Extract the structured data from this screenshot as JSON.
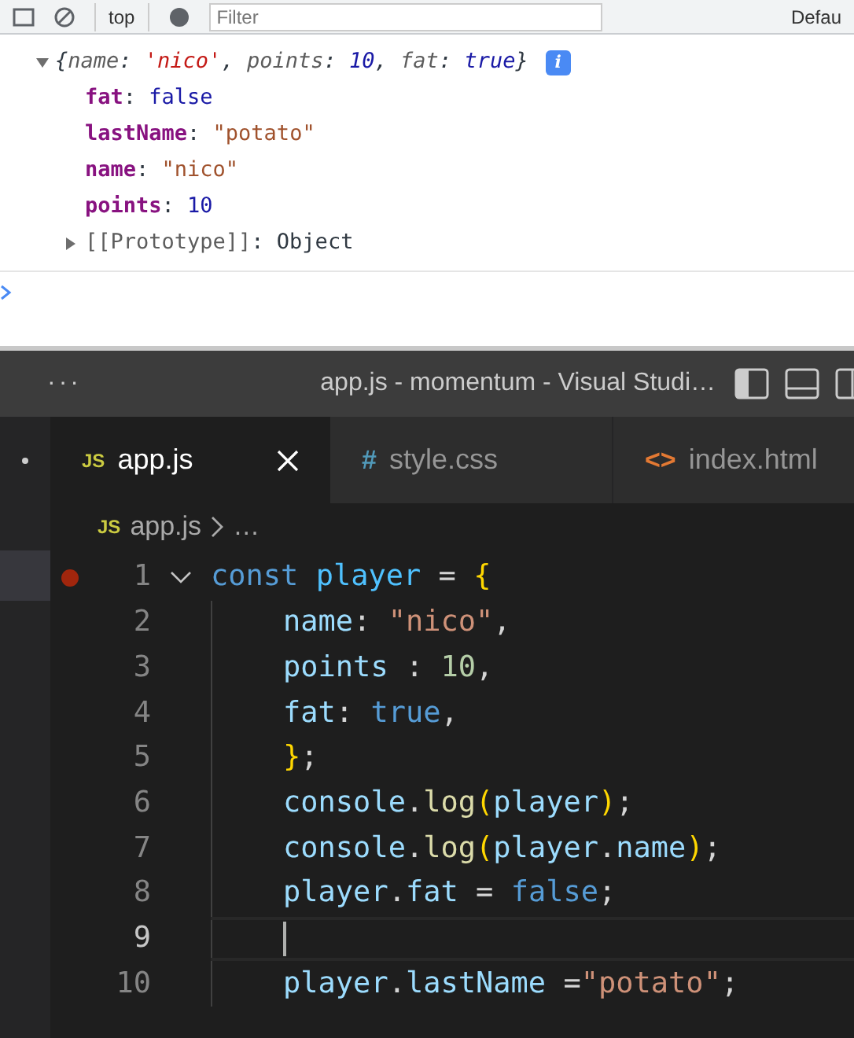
{
  "devtools_toolbar": {
    "context": "top",
    "filter": {
      "placeholder": "Filter"
    },
    "levels": "Defau"
  },
  "console": {
    "expanded": true,
    "summary": [
      {
        "t": "{",
        "kind": "punct"
      },
      {
        "t": "name",
        "kind": "key"
      },
      {
        "t": ": ",
        "kind": "punct"
      },
      {
        "t": "'nico'",
        "kind": "string"
      },
      {
        "t": ", ",
        "kind": "punct"
      },
      {
        "t": "points",
        "kind": "key"
      },
      {
        "t": ": ",
        "kind": "punct"
      },
      {
        "t": "10",
        "kind": "number"
      },
      {
        "t": ", ",
        "kind": "punct"
      },
      {
        "t": "fat",
        "kind": "key"
      },
      {
        "t": ": ",
        "kind": "punct"
      },
      {
        "t": "true",
        "kind": "bool"
      },
      {
        "t": "}",
        "kind": "punct"
      }
    ],
    "info_badge": "i",
    "properties": [
      {
        "key": "fat",
        "separator": ":",
        "value": "false",
        "kind": "bool"
      },
      {
        "key": "lastName",
        "separator": ":",
        "value": "\"potato\"",
        "kind": "string"
      },
      {
        "key": "name",
        "separator": ":",
        "value": "\"nico\"",
        "kind": "string"
      },
      {
        "key": "points",
        "separator": ":",
        "value": "10",
        "kind": "number"
      }
    ],
    "prototype": {
      "key": "[[Prototype]]",
      "separator": ":",
      "value": "Object",
      "expanded": false
    }
  },
  "editor": {
    "title": "app.js - momentum - Visual Studi…",
    "menu": "···",
    "tabs": [
      {
        "icon": "JS",
        "label": "app.js",
        "kind": "js",
        "selected": true
      },
      {
        "icon": "#",
        "label": "style.css",
        "kind": "css",
        "selected": false
      },
      {
        "icon": "<>",
        "label": "index.html",
        "kind": "html",
        "selected": false
      }
    ],
    "breadcrumb": {
      "icon": "JS",
      "file": "app.js",
      "rest": "…"
    },
    "lines": [
      {
        "number": "1",
        "breakpoint": true,
        "fold": true,
        "current": false,
        "indent": false,
        "tokens": [
          {
            "t": "const ",
            "kind": "keyword"
          },
          {
            "t": "player",
            "kind": "constant"
          },
          {
            "t": " = ",
            "kind": "punct"
          },
          {
            "t": "{",
            "kind": "bracket"
          }
        ]
      },
      {
        "number": "2",
        "breakpoint": false,
        "fold": false,
        "current": false,
        "indent": true,
        "tokens": [
          {
            "t": "name",
            "kind": "variable"
          },
          {
            "t": ": ",
            "kind": "punct"
          },
          {
            "t": "\"nico\"",
            "kind": "string"
          },
          {
            "t": ",",
            "kind": "punct"
          }
        ]
      },
      {
        "number": "3",
        "breakpoint": false,
        "fold": false,
        "current": false,
        "indent": true,
        "tokens": [
          {
            "t": "points",
            "kind": "variable"
          },
          {
            "t": " : ",
            "kind": "punct"
          },
          {
            "t": "10",
            "kind": "number"
          },
          {
            "t": ",",
            "kind": "punct"
          }
        ]
      },
      {
        "number": "4",
        "breakpoint": false,
        "fold": false,
        "current": false,
        "indent": true,
        "tokens": [
          {
            "t": "fat",
            "kind": "variable"
          },
          {
            "t": ": ",
            "kind": "punct"
          },
          {
            "t": "true",
            "kind": "keyword"
          },
          {
            "t": ",",
            "kind": "punct"
          }
        ]
      },
      {
        "number": "5",
        "breakpoint": false,
        "fold": false,
        "current": false,
        "indent": true,
        "tokens": [
          {
            "t": "}",
            "kind": "bracket"
          },
          {
            "t": ";",
            "kind": "punct"
          }
        ]
      },
      {
        "number": "6",
        "breakpoint": false,
        "fold": false,
        "current": false,
        "indent": true,
        "tokens": [
          {
            "t": "console",
            "kind": "variable"
          },
          {
            "t": ".",
            "kind": "punct"
          },
          {
            "t": "log",
            "kind": "function"
          },
          {
            "t": "(",
            "kind": "bracket"
          },
          {
            "t": "player",
            "kind": "variable"
          },
          {
            "t": ")",
            "kind": "bracket"
          },
          {
            "t": ";",
            "kind": "punct"
          }
        ]
      },
      {
        "number": "7",
        "breakpoint": false,
        "fold": false,
        "current": false,
        "indent": true,
        "tokens": [
          {
            "t": "console",
            "kind": "variable"
          },
          {
            "t": ".",
            "kind": "punct"
          },
          {
            "t": "log",
            "kind": "function"
          },
          {
            "t": "(",
            "kind": "bracket"
          },
          {
            "t": "player",
            "kind": "variable"
          },
          {
            "t": ".",
            "kind": "punct"
          },
          {
            "t": "name",
            "kind": "variable"
          },
          {
            "t": ")",
            "kind": "bracket"
          },
          {
            "t": ";",
            "kind": "punct"
          }
        ]
      },
      {
        "number": "8",
        "breakpoint": false,
        "fold": false,
        "current": false,
        "indent": true,
        "tokens": [
          {
            "t": "player",
            "kind": "variable"
          },
          {
            "t": ".",
            "kind": "punct"
          },
          {
            "t": "fat",
            "kind": "variable"
          },
          {
            "t": " = ",
            "kind": "punct"
          },
          {
            "t": "false",
            "kind": "keyword"
          },
          {
            "t": ";",
            "kind": "punct"
          }
        ]
      },
      {
        "number": "9",
        "breakpoint": false,
        "fold": false,
        "current": true,
        "indent": true
      },
      {
        "number": "10",
        "breakpoint": false,
        "fold": false,
        "current": false,
        "indent": true,
        "tokens": [
          {
            "t": "player",
            "kind": "variable"
          },
          {
            "t": ".",
            "kind": "punct"
          },
          {
            "t": "lastName",
            "kind": "variable"
          },
          {
            "t": " =",
            "kind": "punct"
          },
          {
            "t": "\"potato\"",
            "kind": "string"
          },
          {
            "t": ";",
            "kind": "punct"
          }
        ]
      }
    ]
  }
}
